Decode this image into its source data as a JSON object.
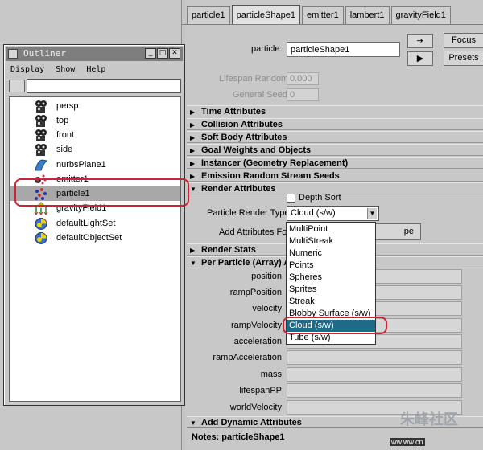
{
  "attribute_editor": {
    "tabs": [
      "particle1",
      "particleShape1",
      "emitter1",
      "lambert1",
      "gravityField1"
    ],
    "active_tab": "particleShape1",
    "node_label": "particle:",
    "node_value": "particleShape1",
    "focus_label": "Focus",
    "presets_label": "Presets",
    "ghost_rows": [
      {
        "label": "Lifespan Random",
        "value": "0.000"
      },
      {
        "label": "General Seed",
        "value": "0"
      }
    ],
    "sections_top": [
      "Time Attributes",
      "Collision Attributes",
      "Soft Body Attributes",
      "Goal Weights and Objects",
      "Instancer (Geometry Replacement)",
      "Emission Random Stream Seeds",
      "Render Attributes"
    ],
    "depth_sort_label": "Depth Sort",
    "particle_render_type_label": "Particle Render Type",
    "particle_render_type_value": "Cloud (s/w)",
    "add_attributes_label": "Add Attributes For",
    "add_attributes_button": "pe",
    "render_stats_label": "Render Stats",
    "per_particle_label": "Per Particle (Array) A",
    "per_particle_attrs": [
      "position",
      "rampPosition",
      "velocity",
      "rampVelocity",
      "acceleration",
      "rampAcceleration",
      "mass",
      "lifespanPP",
      "worldVelocity"
    ],
    "add_dynamic_label": "Add Dynamic Attributes",
    "notes": "Notes: particleShape1"
  },
  "dropdown": {
    "options": [
      "MultiPoint",
      "MultiStreak",
      "Numeric",
      "Points",
      "Spheres",
      "Sprites",
      "Streak",
      "Blobby Surface (s/w)",
      "Cloud (s/w)",
      "Tube (s/w)"
    ],
    "selected": "Cloud (s/w)"
  },
  "outliner": {
    "title": "Outliner",
    "menu": [
      "Display",
      "Show",
      "Help"
    ],
    "items": [
      {
        "label": "persp",
        "icon": "camera-icon"
      },
      {
        "label": "top",
        "icon": "camera-icon"
      },
      {
        "label": "front",
        "icon": "camera-icon"
      },
      {
        "label": "side",
        "icon": "camera-icon"
      },
      {
        "label": "nurbsPlane1",
        "icon": "nurbs-plane-icon"
      },
      {
        "label": "emitter1",
        "icon": "emitter-icon"
      },
      {
        "label": "particle1",
        "icon": "particle-icon"
      },
      {
        "label": "gravityField1",
        "icon": "gravity-field-icon"
      },
      {
        "label": "defaultLightSet",
        "icon": "set-icon"
      },
      {
        "label": "defaultObjectSet",
        "icon": "set-icon"
      }
    ],
    "selected": "particle1"
  },
  "colors": {
    "selection_blue": "#1e6a87",
    "highlight_red": "#cc2233",
    "outliner_selected": "#a8a8a8"
  },
  "watermark": {
    "text": "朱峰社区",
    "sub": "ww.ww.cn"
  }
}
